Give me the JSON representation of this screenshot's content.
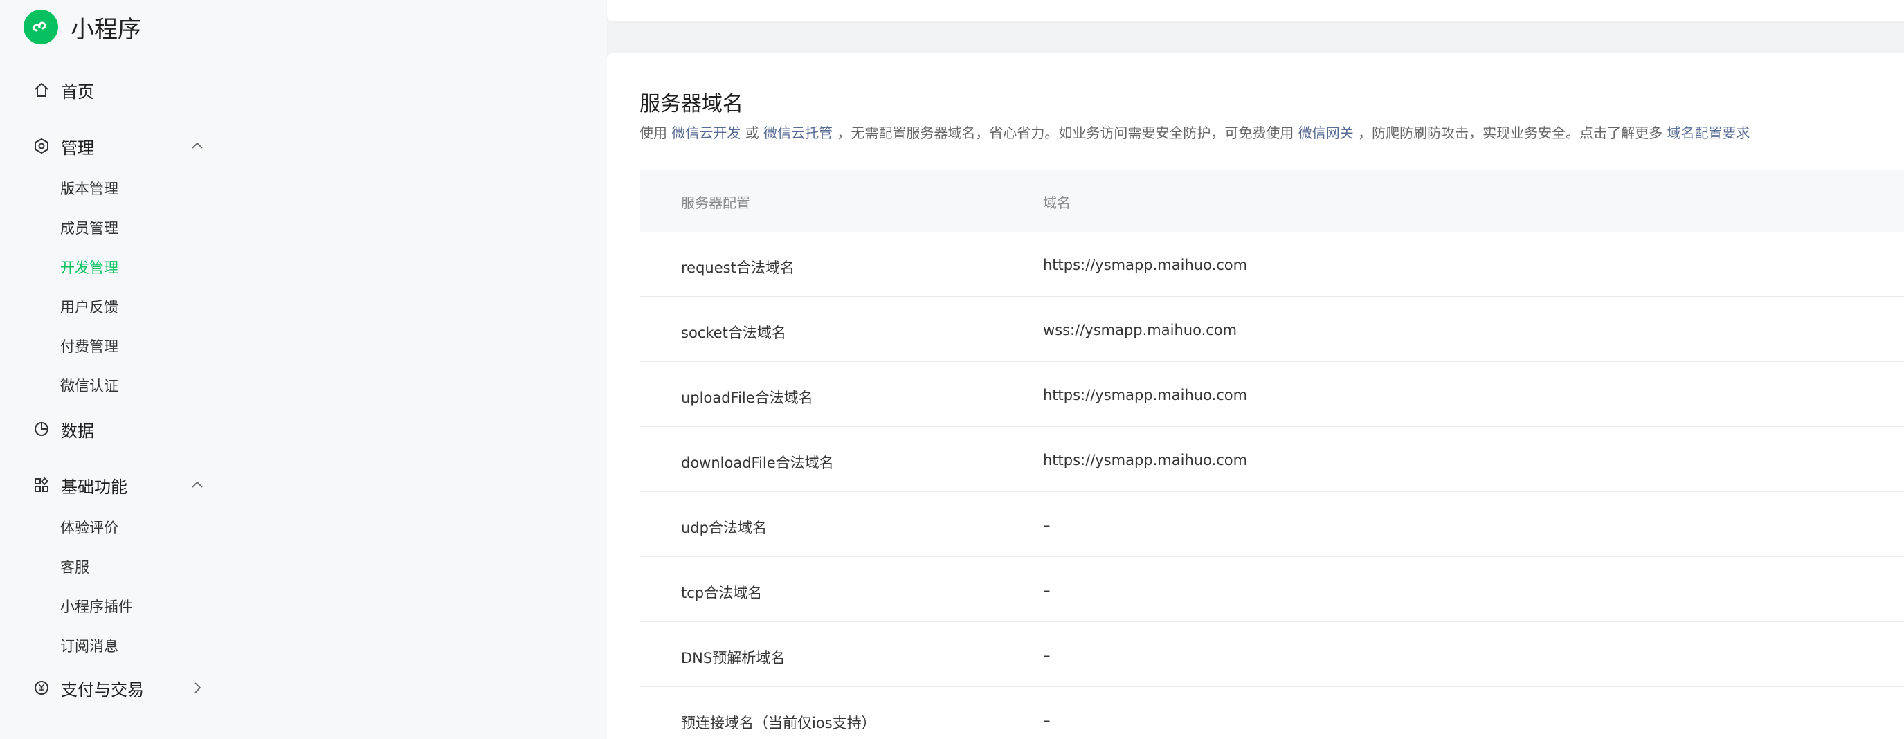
{
  "brand": {
    "title": "小程序"
  },
  "sidebar": {
    "items": [
      {
        "label": "首页"
      },
      {
        "label": "管理",
        "sub": [
          "版本管理",
          "成员管理",
          "开发管理",
          "用户反馈",
          "付费管理",
          "微信认证"
        ]
      },
      {
        "label": "数据"
      },
      {
        "label": "基础功能",
        "sub": [
          "体验评价",
          "客服",
          "小程序插件",
          "订阅消息"
        ]
      },
      {
        "label": "支付与交易"
      }
    ],
    "active": "开发管理"
  },
  "main": {
    "title": "服务器域名",
    "desc": {
      "t1": "使用 ",
      "link1": "微信云开发",
      "t2": " 或 ",
      "link2": "微信云托管",
      "t3": " ，无需配置服务器域名，省心省力。如业务访问需要安全防护，可免费使用 ",
      "link3": "微信网关",
      "t4": " ，防爬防刷防攻击，实现业务安全。点击了解更多 ",
      "link4": "域名配置要求"
    },
    "table": {
      "headers": [
        "服务器配置",
        "域名"
      ],
      "rows": [
        [
          "request合法域名",
          "https://ysmapp.maihuo.com"
        ],
        [
          "socket合法域名",
          "wss://ysmapp.maihuo.com"
        ],
        [
          "uploadFile合法域名",
          "https://ysmapp.maihuo.com"
        ],
        [
          "downloadFile合法域名",
          "https://ysmapp.maihuo.com"
        ],
        [
          "udp合法域名",
          "–"
        ],
        [
          "tcp合法域名",
          "–"
        ],
        [
          "DNS预解析域名",
          "–"
        ],
        [
          "预连接域名（当前仅ios支持）",
          "–"
        ]
      ]
    }
  },
  "colors": {
    "accent": "#07c160",
    "link": "#576b95"
  }
}
